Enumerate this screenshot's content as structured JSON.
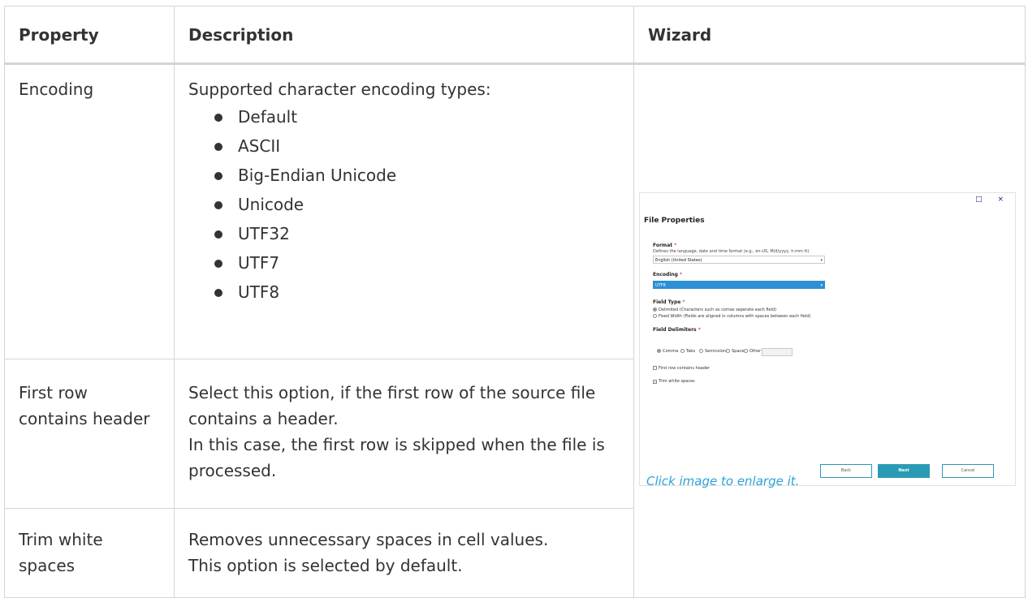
{
  "table": {
    "headers": [
      "Property",
      "Description",
      "Wizard"
    ],
    "rows": [
      {
        "property": "Encoding",
        "description_intro": "Supported character encoding types:",
        "description_list": [
          "Default",
          "ASCII",
          "Big-Endian Unicode",
          "Unicode",
          "UTF32",
          "UTF7",
          "UTF8"
        ]
      },
      {
        "property": "First row contains header",
        "description_lines": [
          "Select this option, if the first row of the source file contains a header.",
          "In this case, the first row is skipped when the file is processed."
        ]
      },
      {
        "property": "Trim white spaces",
        "description_lines": [
          "Removes unnecessary spaces in cell values.",
          "This option is selected by default."
        ]
      }
    ]
  },
  "wizard": {
    "window_buttons": "□ ×",
    "title": "File Properties",
    "format_label": "Format",
    "required_mark": "*",
    "format_hint": "Defines the language, date and time format (e.g., en-US, M/d/yyyy, h:mm tt)",
    "format_value": "English (United States)",
    "encoding_label": "Encoding",
    "encoding_value": "UTF8",
    "field_type_label": "Field Type",
    "field_type_options": [
      "Delimited (Characters such as comas seperate each field)",
      "Fixed Width (Fields are aligned in columns with spaces between each field)"
    ],
    "field_delimiters_label": "Field Delimiters",
    "delimiters": [
      "Comma",
      "Tabs",
      "Semicolon",
      "Space",
      "Other"
    ],
    "first_row_label": "First row contains header",
    "trim_label": "Trim white spaces",
    "buttons": {
      "back": "Back",
      "next": "Next",
      "cancel": "Cancel"
    },
    "caption": "Click image to enlarge it."
  }
}
